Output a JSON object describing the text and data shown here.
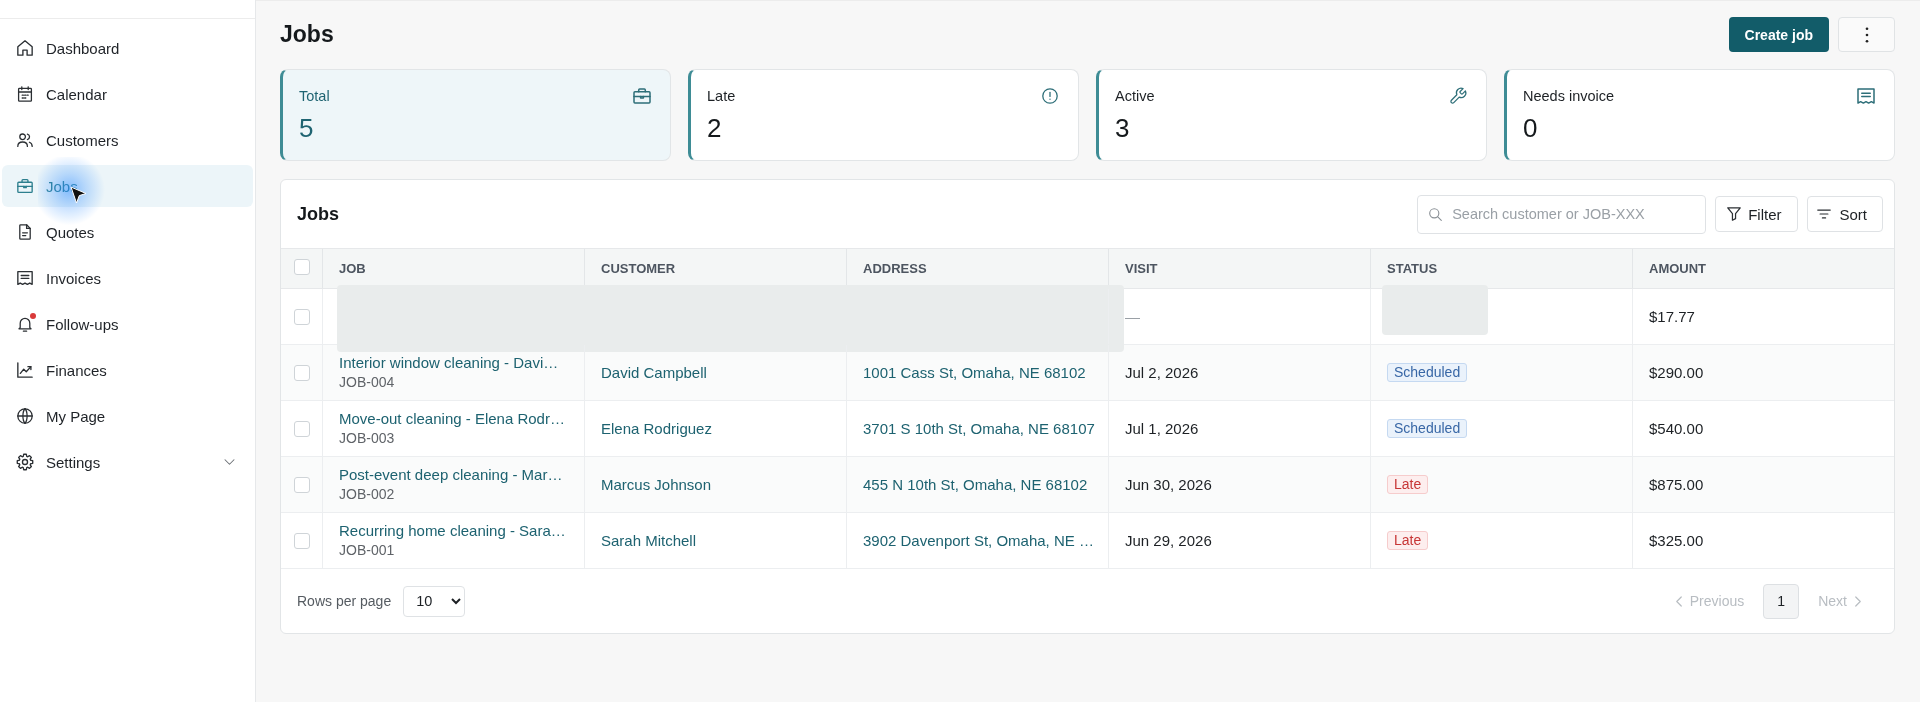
{
  "sidebar": {
    "items": [
      {
        "label": "Dashboard",
        "selected": false,
        "alert": false,
        "kind": "link"
      },
      {
        "label": "Calendar",
        "selected": false,
        "alert": false,
        "kind": "link"
      },
      {
        "label": "Customers",
        "selected": false,
        "alert": false,
        "kind": "link"
      },
      {
        "label": "Jobs",
        "selected": true,
        "alert": false,
        "kind": "link"
      },
      {
        "label": "Quotes",
        "selected": false,
        "alert": false,
        "kind": "link"
      },
      {
        "label": "Invoices",
        "selected": false,
        "alert": false,
        "kind": "link"
      },
      {
        "label": "Follow-ups",
        "selected": false,
        "alert": true,
        "kind": "link"
      },
      {
        "label": "Finances",
        "selected": false,
        "alert": false,
        "kind": "link"
      },
      {
        "label": "My Page",
        "selected": false,
        "alert": false,
        "kind": "link"
      },
      {
        "label": "Settings",
        "selected": false,
        "alert": false,
        "kind": "group",
        "expanded": false
      }
    ]
  },
  "header": {
    "title": "Jobs",
    "primary_action": "Create job"
  },
  "stats": [
    {
      "label": "Total",
      "value": "5",
      "selected": true
    },
    {
      "label": "Late",
      "value": "2",
      "selected": false
    },
    {
      "label": "Active",
      "value": "3",
      "selected": false
    },
    {
      "label": "Needs invoice",
      "value": "0",
      "selected": false
    }
  ],
  "table": {
    "title": "Jobs",
    "search": {
      "placeholder": "Search customer or JOB-XXX"
    },
    "actions": [
      "Filter",
      "Sort"
    ],
    "select_all": {
      "checked": false
    },
    "columns": [
      "JOB",
      "CUSTOMER",
      "ADDRESS",
      "VISIT",
      "STATUS",
      "AMOUNT"
    ],
    "rows": [
      {
        "kind": "loading",
        "selected": false,
        "visit": "—",
        "amount": "$17.77"
      },
      {
        "kind": "job",
        "selected": false,
        "title": "Interior window cleaning - Davi…",
        "job_id": "JOB-004",
        "customer": "David Campbell",
        "address": "1001 Cass St, Omaha, NE 68102",
        "visit": "Jul 2, 2026",
        "status": {
          "label": "Scheduled",
          "kind": "scheduled"
        },
        "amount": "$290.00"
      },
      {
        "kind": "job",
        "selected": false,
        "title": "Move-out cleaning - Elena Rodr…",
        "job_id": "JOB-003",
        "customer": "Elena Rodriguez",
        "address": "3701 S 10th St, Omaha, NE 68107",
        "visit": "Jul 1, 2026",
        "status": {
          "label": "Scheduled",
          "kind": "scheduled"
        },
        "amount": "$540.00"
      },
      {
        "kind": "job",
        "selected": false,
        "title": "Post-event deep cleaning - Mar…",
        "job_id": "JOB-002",
        "customer": "Marcus Johnson",
        "address": "455 N 10th St, Omaha, NE 68102",
        "visit": "Jun 30, 2026",
        "status": {
          "label": "Late",
          "kind": "late"
        },
        "amount": "$875.00"
      },
      {
        "kind": "job",
        "selected": false,
        "title": "Recurring home cleaning - Sara…",
        "job_id": "JOB-001",
        "customer": "Sarah Mitchell",
        "address": "3902 Davenport St, Omaha, NE …",
        "visit": "Jun 29, 2026",
        "status": {
          "label": "Late",
          "kind": "late"
        },
        "amount": "$325.00"
      }
    ]
  },
  "footer": {
    "rows_per_page_label": "Rows per page",
    "rows_per_page": "10",
    "pagination": {
      "previous": {
        "label": "Previous",
        "disabled": true
      },
      "pages": [
        {
          "label": "1",
          "selected": true
        }
      ],
      "next": {
        "label": "Next",
        "disabled": true
      }
    }
  }
}
